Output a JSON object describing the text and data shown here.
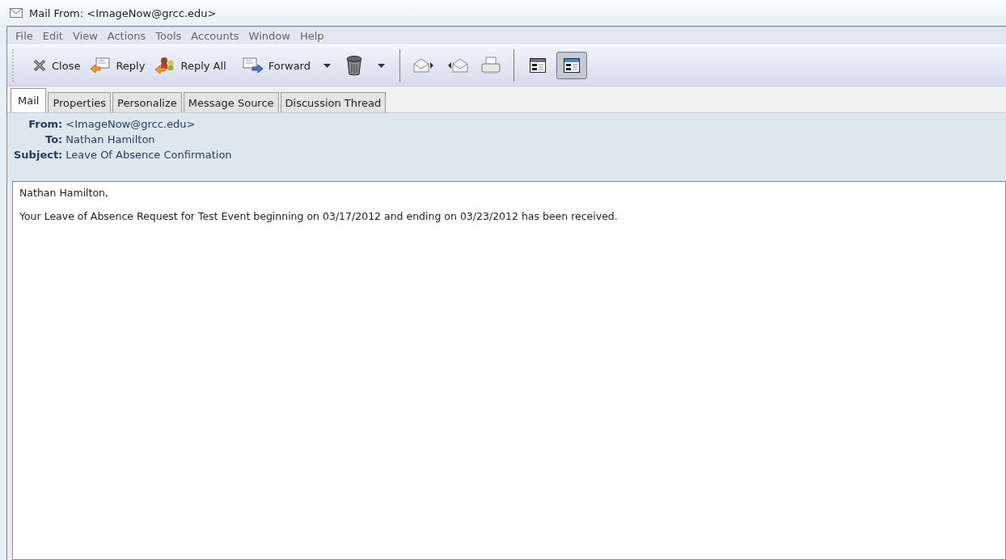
{
  "window": {
    "title": "Mail From: <ImageNow@grcc.edu>"
  },
  "menu": [
    "File",
    "Edit",
    "View",
    "Actions",
    "Tools",
    "Accounts",
    "Window",
    "Help"
  ],
  "toolbar": {
    "close": "Close",
    "reply": "Reply",
    "reply_all": "Reply All",
    "forward": "Forward",
    "view_buttons": [
      {
        "selected": false
      },
      {
        "selected": true
      }
    ]
  },
  "tabs": [
    {
      "label": "Mail",
      "selected": true
    },
    {
      "label": "Properties",
      "selected": false
    },
    {
      "label": "Personalize",
      "selected": false
    },
    {
      "label": "Message Source",
      "selected": false
    },
    {
      "label": "Discussion Thread",
      "selected": false
    }
  ],
  "header": [
    {
      "label": "From:",
      "value": "<ImageNow@grcc.edu>"
    },
    {
      "label": "To:",
      "value": "Nathan Hamilton"
    },
    {
      "label": "Subject:",
      "value": "Leave Of Absence Confirmation"
    }
  ],
  "body": [
    "Nathan Hamilton,",
    "Your Leave of Absence Request for Test Event beginning on 03/17/2012 and ending on 03/23/2012 has been received."
  ]
}
